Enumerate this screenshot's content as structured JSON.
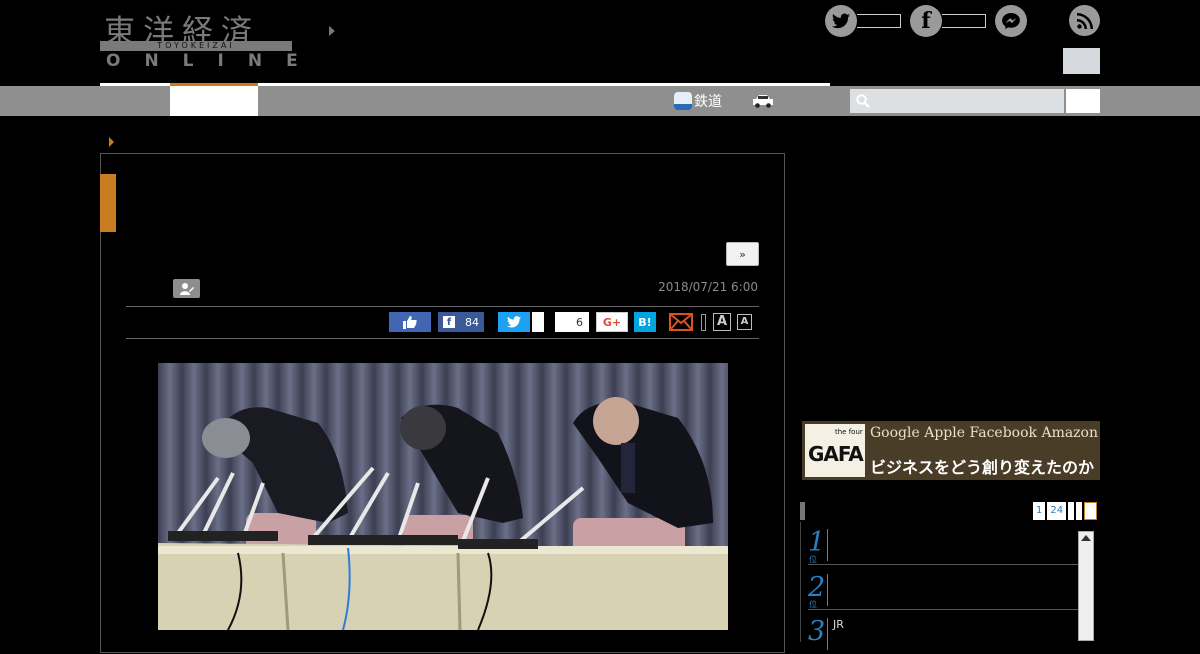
{
  "header": {
    "logo": {
      "kanji": "東洋経済",
      "subtitle": "TOYOKEIZAI",
      "online": "ONLINE"
    },
    "social": [
      {
        "name": "twitter-icon",
        "glyph": "🐦"
      },
      {
        "name": "facebook-icon",
        "glyph": "f"
      },
      {
        "name": "messenger-icon",
        "glyph": "⌁"
      },
      {
        "name": "rss-icon",
        "glyph": "◉"
      }
    ]
  },
  "nav": {
    "rail_label": "鉄道"
  },
  "article": {
    "next_label": "»",
    "date": "2018/07/21 6:00",
    "share": {
      "facebook_count": "84",
      "pocket_count": "6",
      "gplus_label": "G+",
      "hatena_label": "B!",
      "font_large": "A",
      "font_small": "A"
    }
  },
  "sidebar": {
    "banner": {
      "logo_text": "GAFA",
      "logo_small": "the four",
      "line1": "Google Apple Facebook Amazon",
      "line2": "ビジネスをどう創り変えたのか"
    },
    "ranking_tabs": [
      "1",
      "24"
    ],
    "ranking": [
      {
        "num": "1",
        "unit": "位",
        "text": ""
      },
      {
        "num": "2",
        "unit": "位",
        "text": ""
      },
      {
        "num": "3",
        "unit": "",
        "text": "JR"
      }
    ]
  },
  "colors": {
    "accent": "#c97d20",
    "nav_bg": "#8f8f8f",
    "rank_blue": "#2a7fc1"
  }
}
